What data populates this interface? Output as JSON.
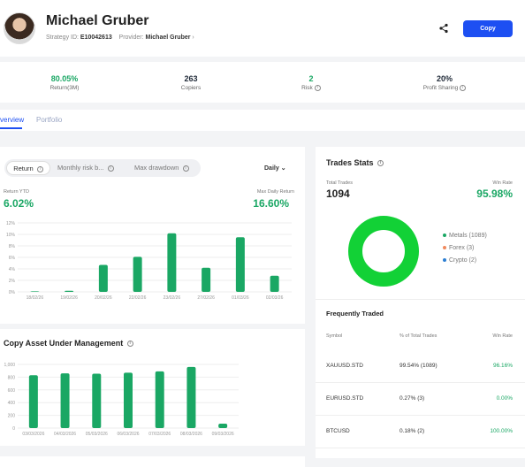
{
  "header": {
    "name": "Michael Gruber",
    "strategy_label": "Strategy ID:",
    "strategy_id": "E10042613",
    "provider_label": "Provider:",
    "provider_name": "Michael Gruber",
    "copy_label": "Copy"
  },
  "stats": [
    {
      "value": "80.05%",
      "label": "Return(3M)",
      "color": "#1aa764"
    },
    {
      "value": "263",
      "label": "Copiers",
      "color": "#222222"
    },
    {
      "value": "2",
      "label": "Risk",
      "color": "#1aa764"
    },
    {
      "value": "20%",
      "label": "Profit Sharing",
      "color": "#222222"
    }
  ],
  "tabs": {
    "overview": "verview",
    "portfolio": "Portfolio"
  },
  "performance": {
    "segments": [
      "Return",
      "Monthly risk b...",
      "Max drawdown"
    ],
    "period": "Daily",
    "return_ytd_label": "Return YTD",
    "return_ytd": "6.02%",
    "max_daily_label": "Max Daily Return",
    "max_daily": "16.60%"
  },
  "aum": {
    "title": "Copy Asset Under Management"
  },
  "trades_stats": {
    "title": "Trades Stats",
    "total_label": "Total Trades",
    "total": "1094",
    "win_label": "Win Rate",
    "win": "95.98%",
    "legend": [
      {
        "label": "Metals (1089)",
        "color": "#1aa764"
      },
      {
        "label": "Forex (3)",
        "color": "#f08a5d"
      },
      {
        "label": "Crypto (2)",
        "color": "#2d7fd3"
      }
    ],
    "donut_color": "#12d136"
  },
  "frequently_traded": {
    "title": "Frequently Traded",
    "headers": [
      "Symbol",
      "% of Total Trades",
      "Win Rate"
    ],
    "rows": [
      {
        "symbol": "XAUUSD.STD",
        "pct": "99.54% (1089)",
        "win": "96.16%"
      },
      {
        "symbol": "EURUSD.STD",
        "pct": "0.27% (3)",
        "win": "0.00%"
      },
      {
        "symbol": "BTCUSD",
        "pct": "0.18% (2)",
        "win": "100.00%"
      }
    ]
  },
  "chart_data": [
    {
      "type": "bar",
      "title": "",
      "categories": [
        "18/02/26",
        "19/02/26",
        "20/02/26",
        "22/02/26",
        "23/02/26",
        "27/02/26",
        "01/03/26",
        "02/03/26"
      ],
      "values": [
        0.1,
        0.2,
        4.7,
        6.1,
        10.2,
        4.2,
        9.5,
        2.8
      ],
      "ylim": [
        0,
        12
      ],
      "yticks": [
        "0%",
        "2%",
        "4%",
        "6%",
        "8%",
        "10%",
        "12%"
      ],
      "color": "#1aa764"
    },
    {
      "type": "bar",
      "title": "Copy Asset Under Management",
      "categories": [
        "03/03/2026",
        "04/03/2026",
        "05/03/2026",
        "06/03/2026",
        "07/03/2026",
        "08/03/2026",
        "09/03/2026"
      ],
      "values": [
        830,
        860,
        855,
        870,
        890,
        960,
        70
      ],
      "ylim": [
        0,
        1000
      ],
      "yticks": [
        "0",
        "200",
        "400",
        "600",
        "800",
        "1,000"
      ],
      "color": "#1aa764"
    }
  ]
}
